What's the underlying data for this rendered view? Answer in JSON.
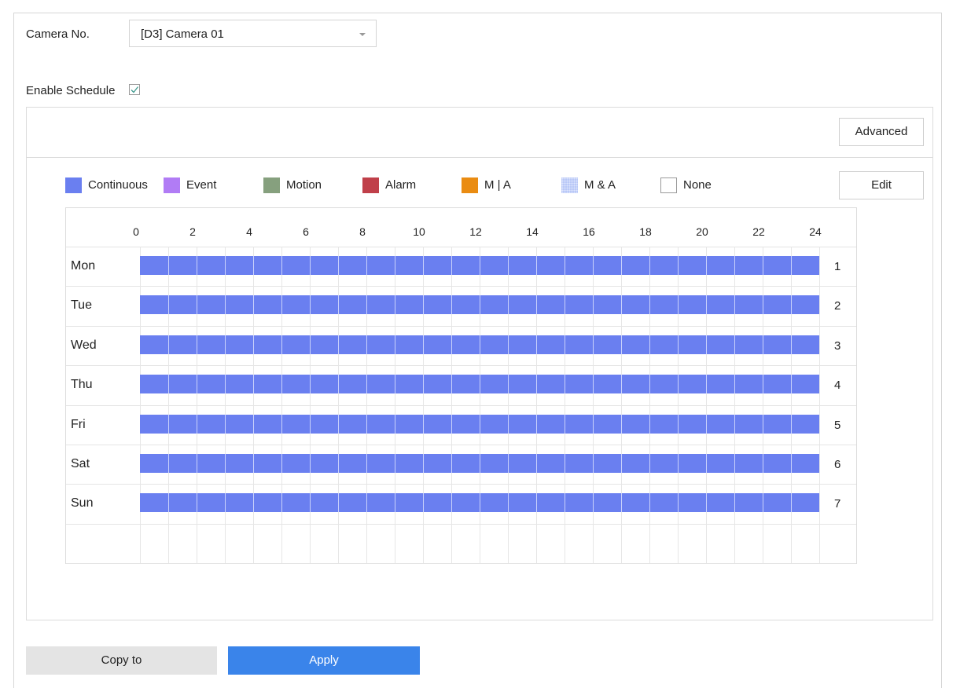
{
  "camera": {
    "label": "Camera No.",
    "selected": "[D3] Camera 01"
  },
  "schedule": {
    "enable_label": "Enable Schedule",
    "enabled": true
  },
  "buttons": {
    "advanced": "Advanced",
    "edit": "Edit",
    "copy_to": "Copy to",
    "apply": "Apply"
  },
  "legend": [
    {
      "label": "Continuous",
      "color": "#6a7ff0"
    },
    {
      "label": "Event",
      "color": "#b17cf5"
    },
    {
      "label": "Motion",
      "color": "#86a07e"
    },
    {
      "label": "Alarm",
      "color": "#c0404a"
    },
    {
      "label": "M | A",
      "color": "#ea8c12"
    },
    {
      "label": "M & A",
      "color": "#b9c8f7",
      "pattern": "dotted"
    },
    {
      "label": "None",
      "color": "#ffffff"
    }
  ],
  "hours": [
    "0",
    "2",
    "4",
    "6",
    "8",
    "10",
    "12",
    "14",
    "16",
    "18",
    "20",
    "22",
    "24"
  ],
  "days": [
    {
      "name": "Mon",
      "num": "1",
      "type": "Continuous",
      "start": 0,
      "end": 24
    },
    {
      "name": "Tue",
      "num": "2",
      "type": "Continuous",
      "start": 0,
      "end": 24
    },
    {
      "name": "Wed",
      "num": "3",
      "type": "Continuous",
      "start": 0,
      "end": 24
    },
    {
      "name": "Thu",
      "num": "4",
      "type": "Continuous",
      "start": 0,
      "end": 24
    },
    {
      "name": "Fri",
      "num": "5",
      "type": "Continuous",
      "start": 0,
      "end": 24
    },
    {
      "name": "Sat",
      "num": "6",
      "type": "Continuous",
      "start": 0,
      "end": 24
    },
    {
      "name": "Sun",
      "num": "7",
      "type": "Continuous",
      "start": 0,
      "end": 24
    }
  ]
}
